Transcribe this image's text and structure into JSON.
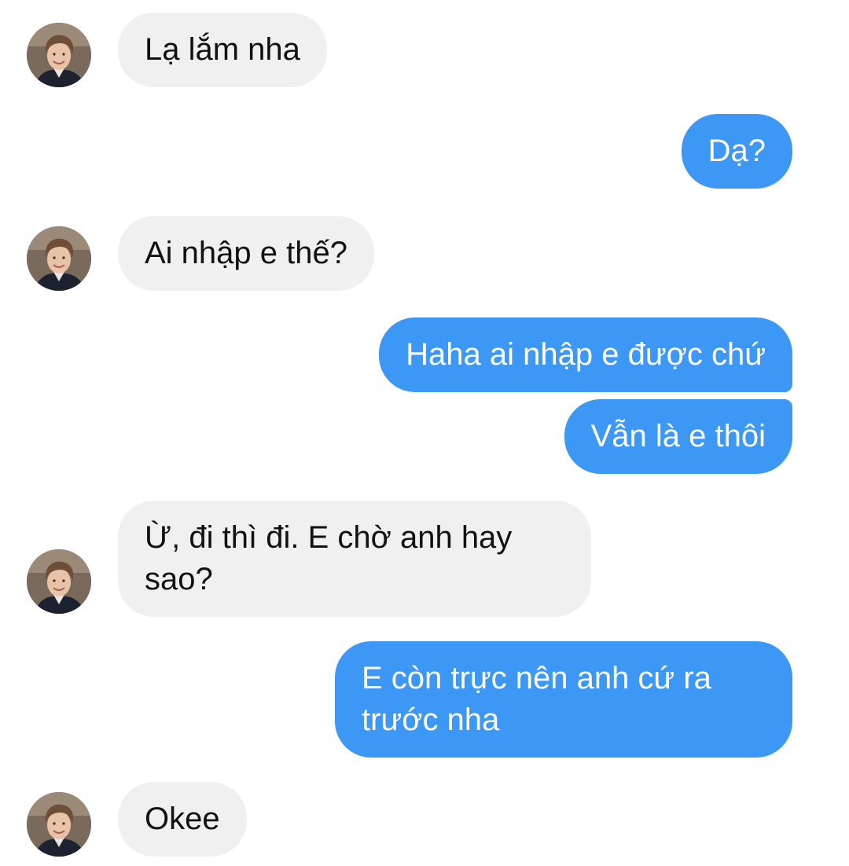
{
  "colors": {
    "incoming_bubble": "#f0f0f0",
    "outgoing_bubble": "#3d98f5",
    "incoming_text": "#111111",
    "outgoing_text": "#ffffff"
  },
  "contact": {
    "avatar_icon": "profile-photo"
  },
  "messages": [
    {
      "direction": "incoming",
      "text": "Lạ lắm nha"
    },
    {
      "direction": "outgoing",
      "text": "Dạ?"
    },
    {
      "direction": "incoming",
      "text": "Ai nhập e thế?"
    },
    {
      "direction": "outgoing",
      "text": "Haha ai nhập e được chứ"
    },
    {
      "direction": "outgoing",
      "text": "Vẫn là e thôi"
    },
    {
      "direction": "incoming",
      "text": "Ừ, đi thì đi. E chờ anh hay sao?"
    },
    {
      "direction": "outgoing",
      "text": "E còn trực nên anh cứ ra trước nha"
    },
    {
      "direction": "incoming",
      "text": "Okee"
    }
  ]
}
